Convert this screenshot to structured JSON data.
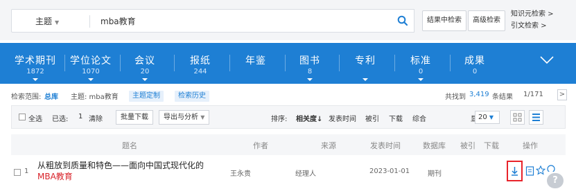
{
  "search": {
    "field": "主题",
    "query": "mba教育",
    "btn_within": "结果中检索",
    "btn_advanced": "高级检索",
    "link_knowledge": "知识元检索 >",
    "link_citation": "引文检索 >"
  },
  "tabs": [
    {
      "label": "学术期刊",
      "count": "1872",
      "arrow": true
    },
    {
      "label": "学位论文",
      "count": "1070",
      "arrow": true
    },
    {
      "label": "会议",
      "count": "20",
      "arrow": true
    },
    {
      "label": "报纸",
      "count": "244",
      "arrow": false
    },
    {
      "label": "年鉴",
      "count": "",
      "arrow": false
    },
    {
      "label": "图书",
      "count": "8",
      "arrow": true
    },
    {
      "label": "专利",
      "count": "",
      "arrow": true
    },
    {
      "label": "标准",
      "count": "0",
      "arrow": true
    },
    {
      "label": "成果",
      "count": "0",
      "arrow": false
    }
  ],
  "scope": {
    "label": "检索范围:",
    "db": "总库",
    "topic": "主题: mba教育",
    "chip_custom": "主题定制",
    "chip_history": "检索历史",
    "found_prefix": "共找到",
    "found_count": "3,419",
    "found_suffix": "条结果",
    "page": "1/171",
    "next": ">"
  },
  "toolbar": {
    "select_all": "全选",
    "selected_label": "已选:",
    "selected_count": "1",
    "clear": "清除",
    "batch_download": "批量下载",
    "export": "导出与分析",
    "sort_label": "排序:",
    "sort_active": "相关度",
    "sort_date": "发表时间",
    "sort_cited": "被引",
    "sort_download": "下载",
    "sort_composite": "综合",
    "display_label": "显示",
    "display_value": "20"
  },
  "table": {
    "headers": {
      "title": "题名",
      "author": "作者",
      "source": "来源",
      "date": "发表时间",
      "db": "数据库",
      "cited": "被引",
      "download": "下载",
      "ops": "操作"
    },
    "rows": [
      {
        "num": "1",
        "title_plain": "从粗放到质量和特色——面向中国式现代化的",
        "title_hl": "MBA教育",
        "author": "王永贵",
        "source": "经理人",
        "date": "2023-01-01",
        "db": "期刊"
      }
    ]
  },
  "help": "?",
  "colors": {
    "accent": "#1e7fd4",
    "highlight": "#d8232a"
  }
}
